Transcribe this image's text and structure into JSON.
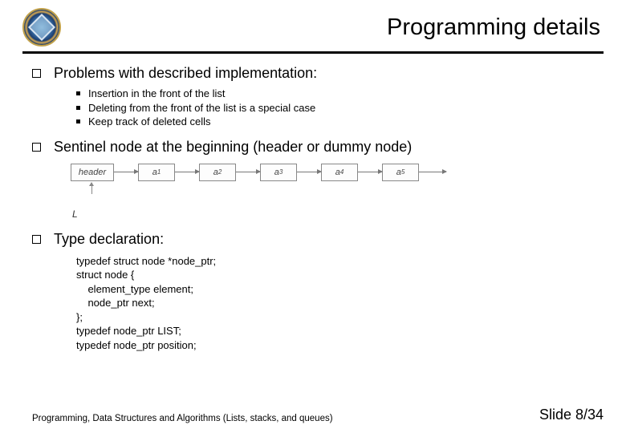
{
  "title": "Programming details",
  "sections": [
    {
      "heading": "Problems with described implementation:",
      "bullets": [
        "Insertion in the front of the list",
        "Deleting from the front of the list is a special case",
        "Keep track of deleted cells"
      ]
    },
    {
      "heading": "Sentinel node at the beginning (header or dummy node)"
    },
    {
      "heading": "Type declaration:"
    }
  ],
  "diagram": {
    "header_label": "header",
    "nodes": [
      "a",
      "a",
      "a",
      "a",
      "a"
    ],
    "subscripts": [
      "1",
      "2",
      "3",
      "4",
      "5"
    ],
    "pointer_label": "L"
  },
  "code": "typedef struct node *node_ptr;\nstruct node {\n    element_type element;\n    node_ptr next;\n};\ntypedef node_ptr LIST;\ntypedef node_ptr position;",
  "footer": {
    "left": "Programming, Data Structures and Algorithms  (Lists, stacks, and queues)",
    "right": "Slide 8/34"
  }
}
